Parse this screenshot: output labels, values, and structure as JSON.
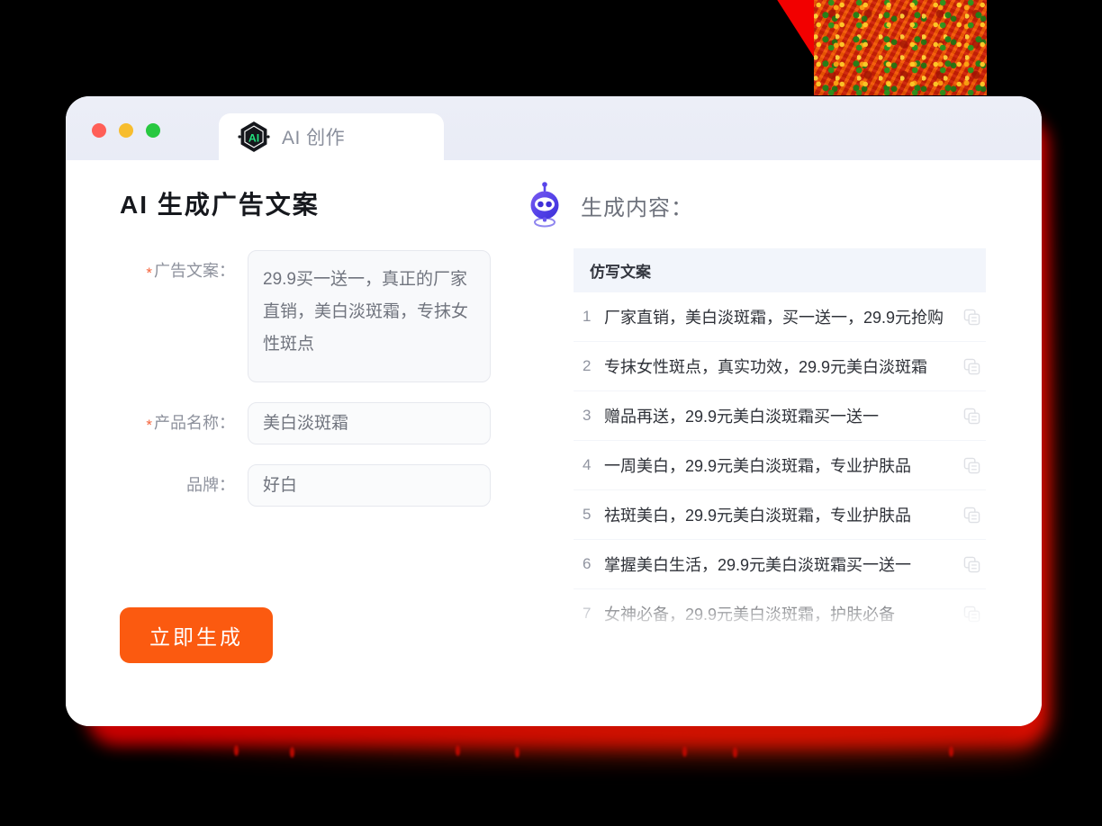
{
  "window": {
    "traffic_lights": [
      {
        "name": "close",
        "color": "#ff5f57"
      },
      {
        "name": "minimize",
        "color": "#f7bd2e"
      },
      {
        "name": "zoom",
        "color": "#28c840"
      }
    ],
    "tab": {
      "logo_text": "AI",
      "label": "AI 创作"
    }
  },
  "left_panel": {
    "title": "AI 生成广告文案",
    "fields": [
      {
        "label": "广告文案：",
        "required": true,
        "type": "textarea",
        "value": "29.9买一送一，真正的厂家直销，美白淡斑霜，专抹女性斑点"
      },
      {
        "label": "产品名称：",
        "required": true,
        "type": "input",
        "value": "美白淡斑霜"
      },
      {
        "label": "品牌：",
        "required": false,
        "type": "input",
        "value": "好白"
      }
    ],
    "submit_label": "立即生成",
    "submit_color": "#fb5a10"
  },
  "right_panel": {
    "heading": "生成内容：",
    "robot_icon": "robot-icon",
    "table": {
      "header": "仿写文案",
      "rows": [
        {
          "num": "1",
          "text": "厂家直销，美白淡斑霜，买一送一，29.9元抢购",
          "copy_icon": "copy-icon"
        },
        {
          "num": "2",
          "text": "专抹女性斑点，真实功效，29.9元美白淡斑霜",
          "copy_icon": "copy-icon"
        },
        {
          "num": "3",
          "text": "赠品再送，29.9元美白淡斑霜买一送一",
          "copy_icon": "copy-icon"
        },
        {
          "num": "4",
          "text": "一周美白，29.9元美白淡斑霜，专业护肤品",
          "copy_icon": "copy-icon"
        },
        {
          "num": "5",
          "text": "祛斑美白，29.9元美白淡斑霜，专业护肤品",
          "copy_icon": "copy-icon"
        },
        {
          "num": "6",
          "text": "掌握美白生活，29.9元美白淡斑霜买一送一",
          "copy_icon": "copy-icon"
        },
        {
          "num": "7",
          "text": "女神必备，29.9元美白淡斑霜，护肤必备",
          "copy_icon": "copy-icon"
        }
      ]
    }
  },
  "decor": {
    "glow_color": "#f10000",
    "texture_name": "red-noise-texture"
  }
}
